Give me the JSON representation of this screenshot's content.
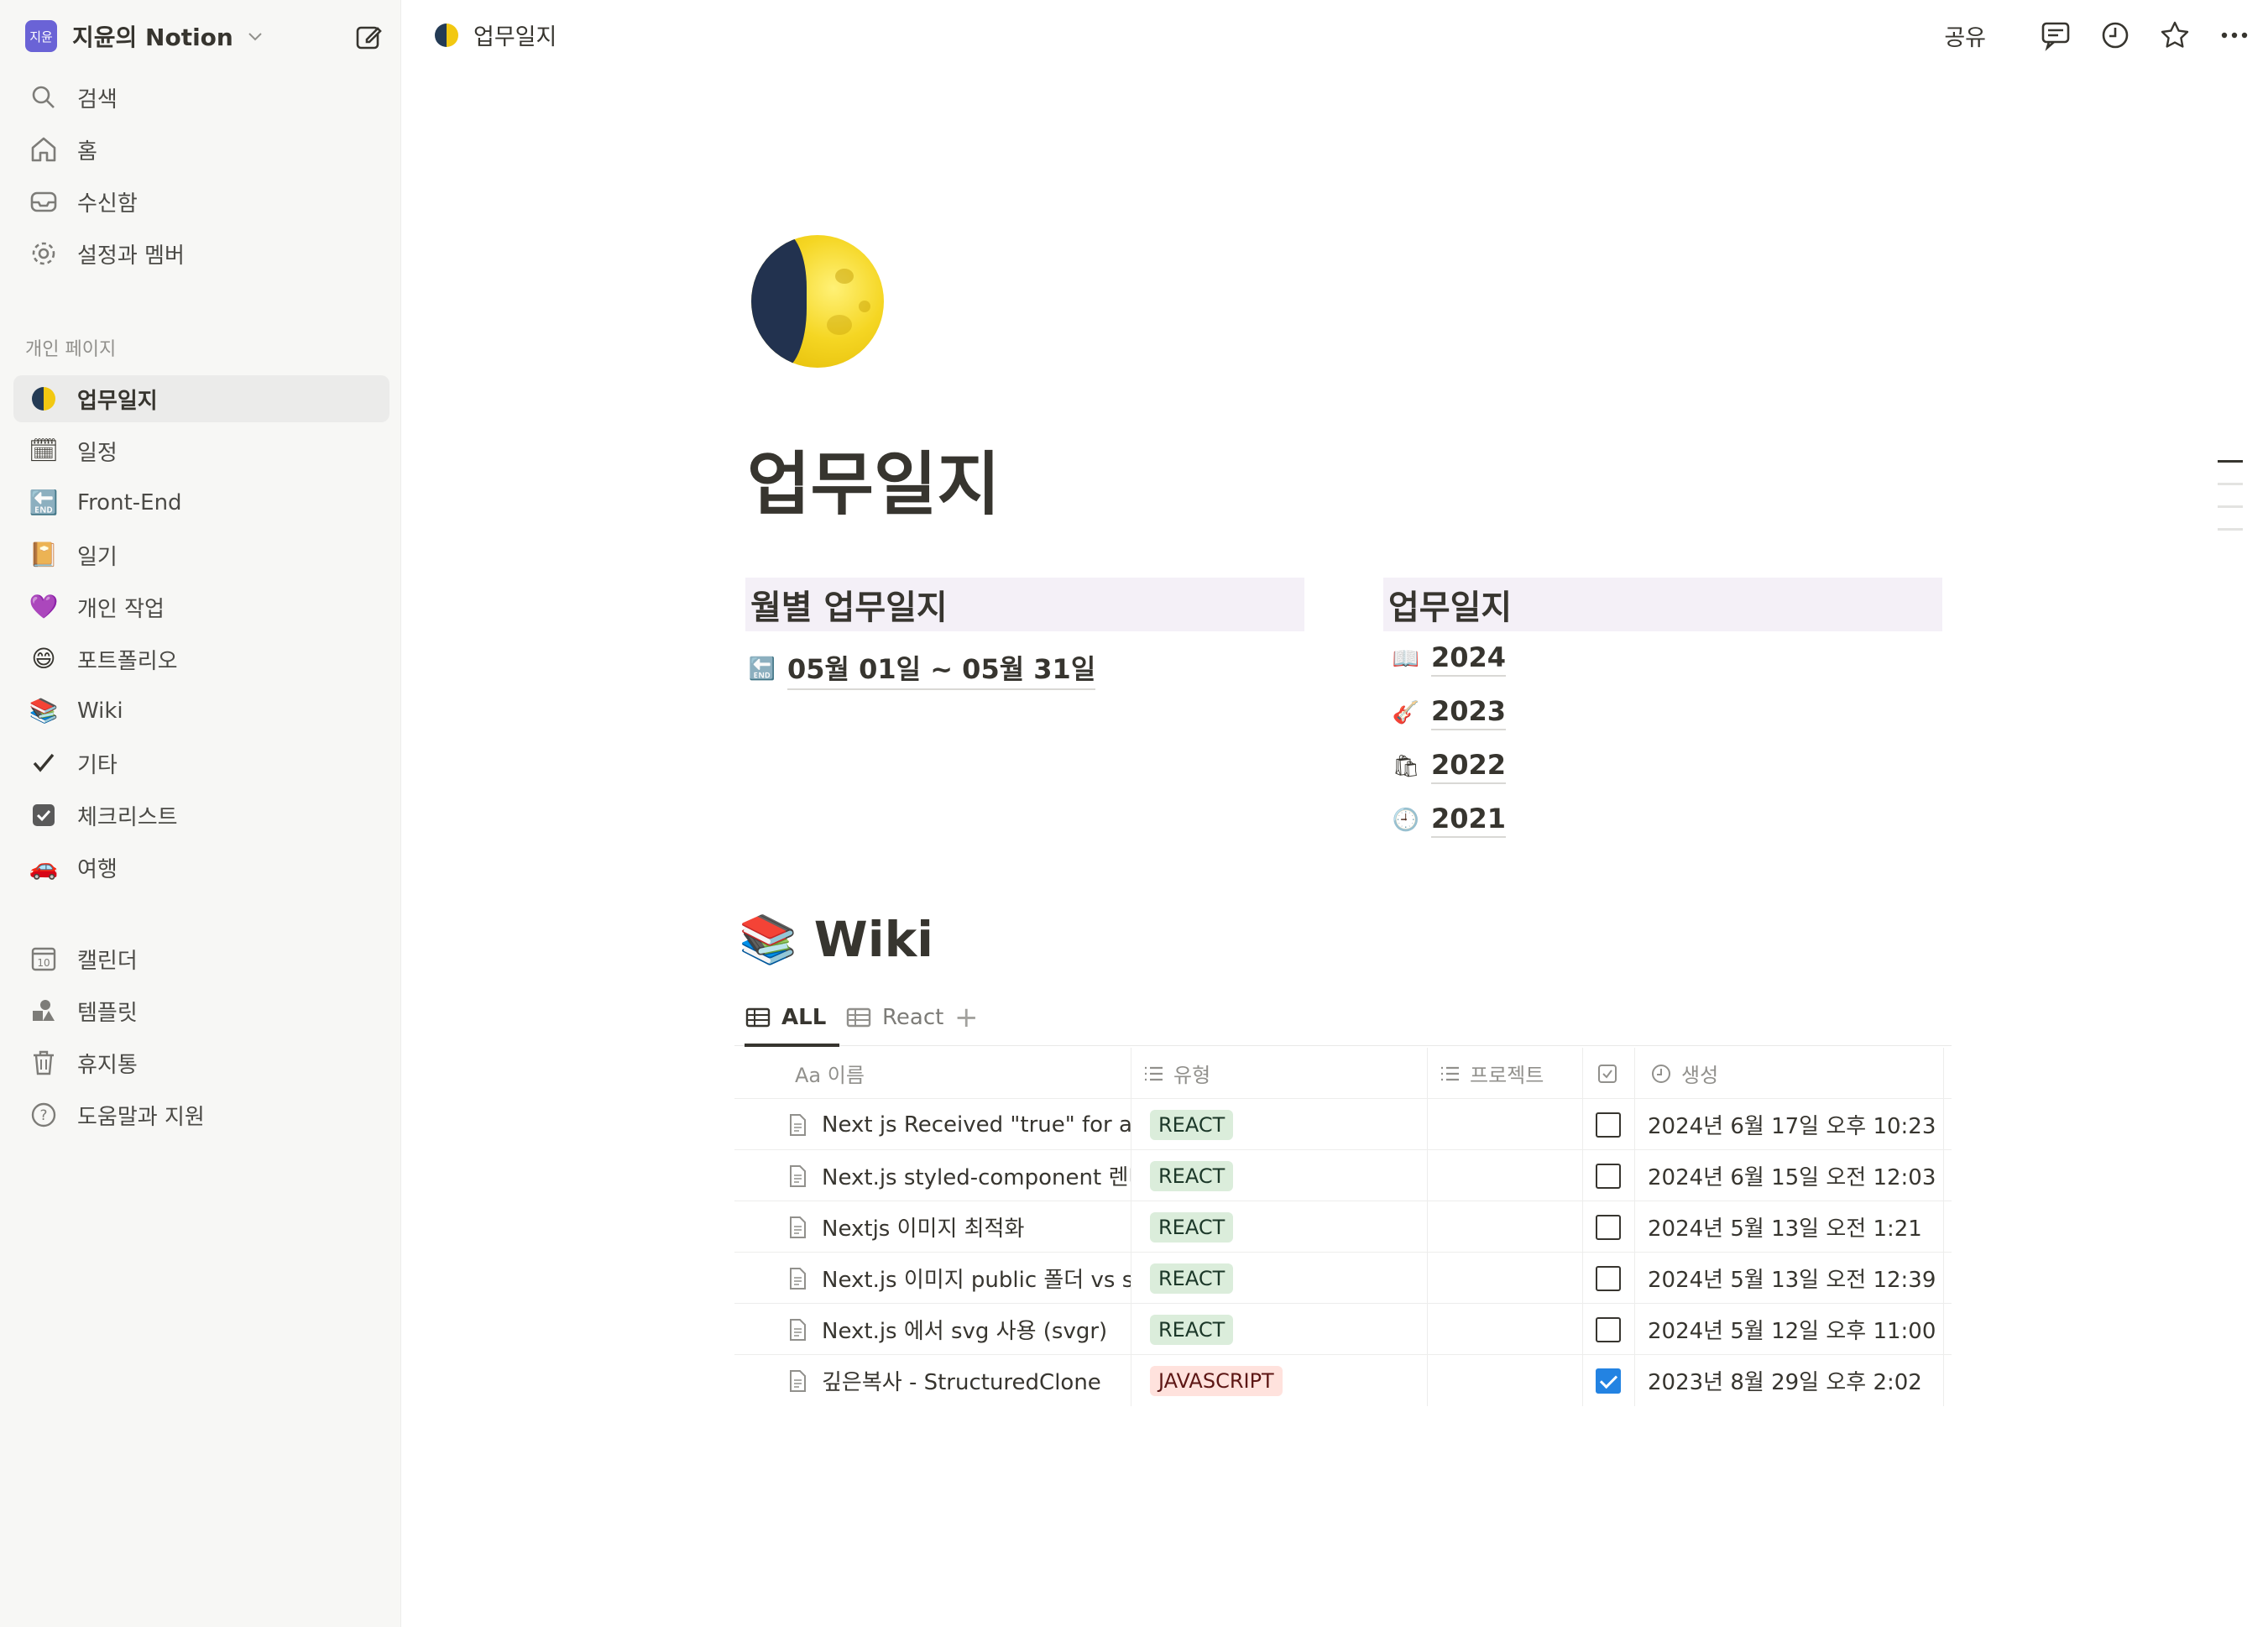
{
  "workspace": {
    "badge": "지윤",
    "name": "지윤의 Notion"
  },
  "nav_main": [
    {
      "label": "검색",
      "icon": "search-icon"
    },
    {
      "label": "홈",
      "icon": "home-icon"
    },
    {
      "label": "수신함",
      "icon": "inbox-icon"
    },
    {
      "label": "설정과 멤버",
      "icon": "settings-icon"
    }
  ],
  "private_section_label": "개인 페이지",
  "private_pages": [
    {
      "label": "업무일지",
      "icon": "moon-icon",
      "active": true
    },
    {
      "label": "일정",
      "icon": "calendar-emoji-icon"
    },
    {
      "label": "Front-End",
      "icon": "end-arrow-icon"
    },
    {
      "label": "일기",
      "icon": "notebook-icon"
    },
    {
      "label": "개인 작업",
      "icon": "purple-heart-icon"
    },
    {
      "label": "포트폴리오",
      "icon": "smile-icon"
    },
    {
      "label": "Wiki",
      "icon": "books-icon"
    },
    {
      "label": "기타",
      "icon": "check-mark-icon"
    },
    {
      "label": "체크리스트",
      "icon": "checkbox-icon"
    },
    {
      "label": "여행",
      "icon": "car-icon"
    }
  ],
  "nav_bottom": [
    {
      "label": "캘린더",
      "icon": "calendar-icon"
    },
    {
      "label": "템플릿",
      "icon": "shapes-icon"
    },
    {
      "label": "휴지통",
      "icon": "trash-icon"
    },
    {
      "label": "도움말과 지원",
      "icon": "help-icon"
    }
  ],
  "topbar": {
    "breadcrumb": "업무일지",
    "share": "공유"
  },
  "page": {
    "title": "업무일지",
    "left_heading": "월별 업무일지",
    "left_links": [
      {
        "text": "05월 01일 ~ 05월 31일",
        "icon": "end-arrow-icon"
      }
    ],
    "right_heading": "업무일지",
    "right_links": [
      {
        "text": "2024",
        "icon": "open-book-icon",
        "emoji": "📖"
      },
      {
        "text": "2023",
        "icon": "guitar-icon",
        "emoji": "🎸"
      },
      {
        "text": "2022",
        "icon": "shopping-bags-icon",
        "emoji": "🛍"
      },
      {
        "text": "2021",
        "icon": "clock-icon",
        "emoji": "🕘"
      }
    ]
  },
  "wiki": {
    "title": "Wiki",
    "tabs": [
      "ALL",
      "React"
    ],
    "columns": {
      "name": "Aa 이름",
      "type": "유형",
      "project": "프로젝트",
      "created": "생성"
    },
    "rows": [
      {
        "name": "Next js Received \"true\" for a non-boolean attribute",
        "type": "REACT",
        "checked": false,
        "created": "2024년 6월 17일 오후 10:23"
      },
      {
        "name": "Next.js styled-component 렌더링 오류",
        "type": "REACT",
        "checked": false,
        "created": "2024년 6월 15일 오전 12:03"
      },
      {
        "name": "Nextjs 이미지 최적화",
        "type": "REACT",
        "checked": false,
        "created": "2024년 5월 13일 오전 1:21"
      },
      {
        "name": "Next.js 이미지 public 폴더 vs src",
        "type": "REACT",
        "checked": false,
        "created": "2024년 5월 13일 오전 12:39"
      },
      {
        "name": "Next.js 에서 svg 사용 (svgr)",
        "type": "REACT",
        "checked": false,
        "created": "2024년 5월 12일 오후 11:00"
      },
      {
        "name": "깊은복사 - StructuredClone",
        "type": "JAVASCRIPT",
        "checked": true,
        "created": "2023년 8월 29일 오후 2:02"
      }
    ]
  },
  "colors": {
    "sidebar_bg": "#f7f7f5",
    "react_tag": "#dbeddb",
    "js_tag": "#ffe2dd",
    "checkbox_on": "#2383e2",
    "heading_bg": "#f4f0f7"
  }
}
